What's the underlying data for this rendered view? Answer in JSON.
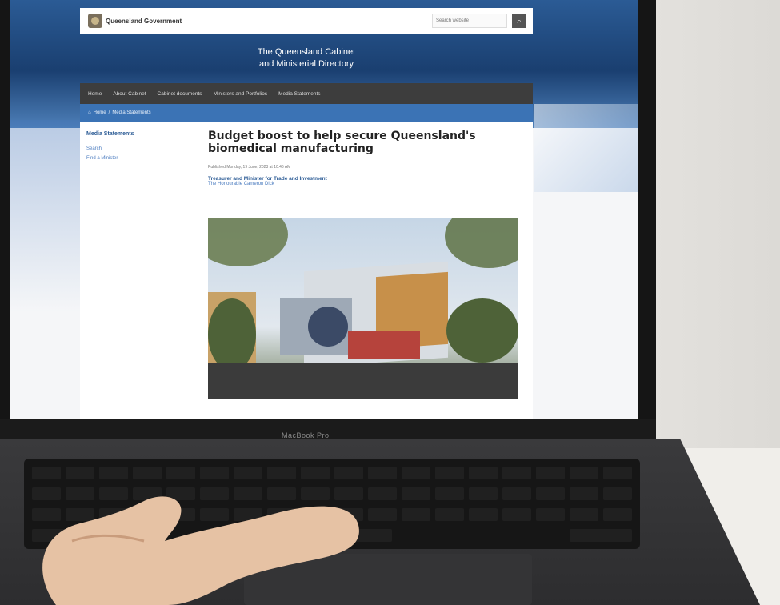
{
  "site": {
    "logo_text": "Queensland Government",
    "search": {
      "placeholder": "Search website",
      "button_icon": "search-icon"
    },
    "title_line1": "The Queensland Cabinet",
    "title_line2": "and Ministerial Directory",
    "nav": [
      "Home",
      "About Cabinet",
      "Cabinet documents",
      "Ministers and Portfolios",
      "Media Statements"
    ],
    "breadcrumb": {
      "home_icon": "home-icon",
      "home": "Home",
      "current": "Media Statements"
    },
    "sidebar": {
      "title": "Media Statements",
      "links": [
        "Search",
        "Find a Minister"
      ]
    },
    "article": {
      "headline": "Budget boost to help secure Queensland's biomedical manufacturing",
      "published": "Published Monday, 19 June, 2023 at 10:46 AM",
      "minister": "Treasurer and Minister for Trade and Investment",
      "minister_name": "The Honourable Cameron Dick"
    }
  },
  "device": {
    "brand": "MacBook Pro"
  }
}
